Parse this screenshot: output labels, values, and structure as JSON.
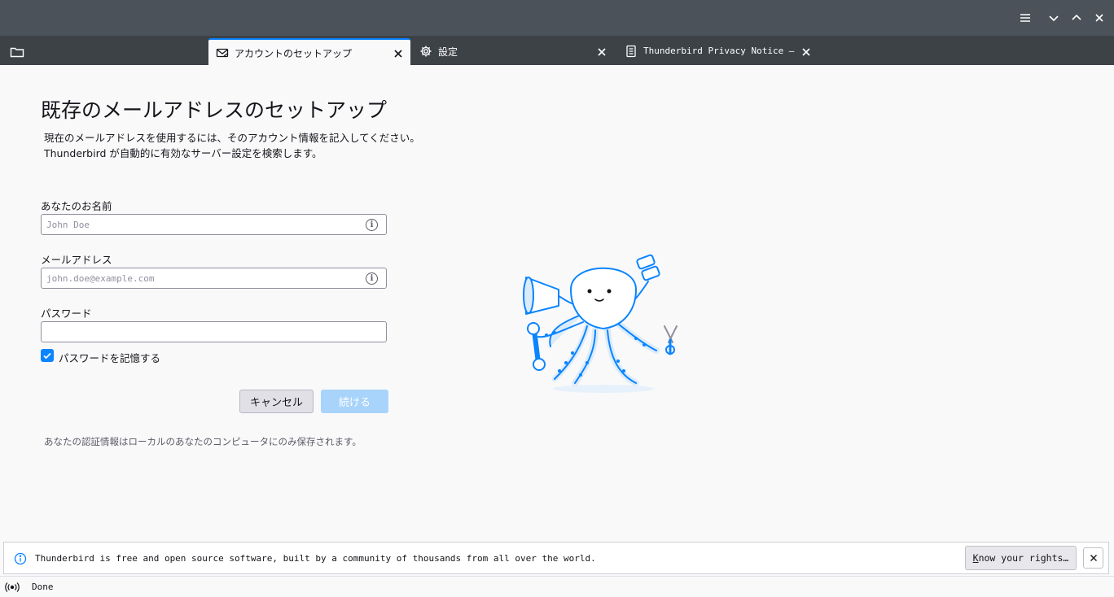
{
  "tabs": [
    {
      "label": "アカウントのセットアップ",
      "icon": "account-setup-icon",
      "active": true
    },
    {
      "label": "設定",
      "icon": "gear-icon",
      "active": false
    },
    {
      "label": "Thunderbird Privacy Notice — Moz",
      "icon": "document-icon",
      "active": false
    }
  ],
  "main": {
    "title": "既存のメールアドレスのセットアップ",
    "description": "現在のメールアドレスを使用するには、そのアカウント情報を記入してください。\nThunderbird が自動的に有効なサーバー設定を検索します。",
    "name_label": "あなたのお名前",
    "name_placeholder": "John Doe",
    "email_label": "メールアドレス",
    "email_placeholder": "john.doe@example.com",
    "password_label": "パスワード",
    "remember_password_label": "パスワードを記憶する",
    "remember_password_checked": true,
    "cancel_label": "キャンセル",
    "continue_label": "続ける",
    "footnote": "あなたの認証情報はローカルのあなたのコンピュータにのみ保存されます。"
  },
  "notification": {
    "text": "Thunderbird is free and open source software, built by a community of thousands from all over the world.",
    "button_access_key": "K",
    "button_rest": "now your rights…"
  },
  "status": {
    "text": "Done"
  },
  "colors": {
    "accent": "#0a84ff",
    "titlebar": "#4b5259",
    "tabbar": "#3d4247"
  }
}
